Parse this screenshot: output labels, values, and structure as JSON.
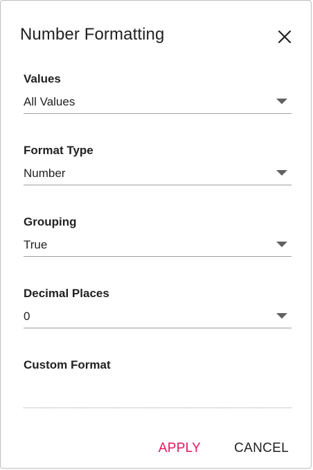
{
  "dialog": {
    "title": "Number Formatting"
  },
  "fields": {
    "values": {
      "label": "Values",
      "value": "All Values"
    },
    "format_type": {
      "label": "Format Type",
      "value": "Number"
    },
    "grouping": {
      "label": "Grouping",
      "value": "True"
    },
    "decimal_places": {
      "label": "Decimal Places",
      "value": "0"
    },
    "custom_format": {
      "label": "Custom Format",
      "value": "",
      "placeholder": ""
    }
  },
  "actions": {
    "apply_label": "APPLY",
    "cancel_label": "CANCEL"
  },
  "colors": {
    "accent": "#e3165b",
    "text": "#212121",
    "caret": "#616161",
    "underline": "#9e9e9e"
  },
  "icons": {
    "close": "close-icon",
    "dropdown": "chevron-down-icon"
  }
}
